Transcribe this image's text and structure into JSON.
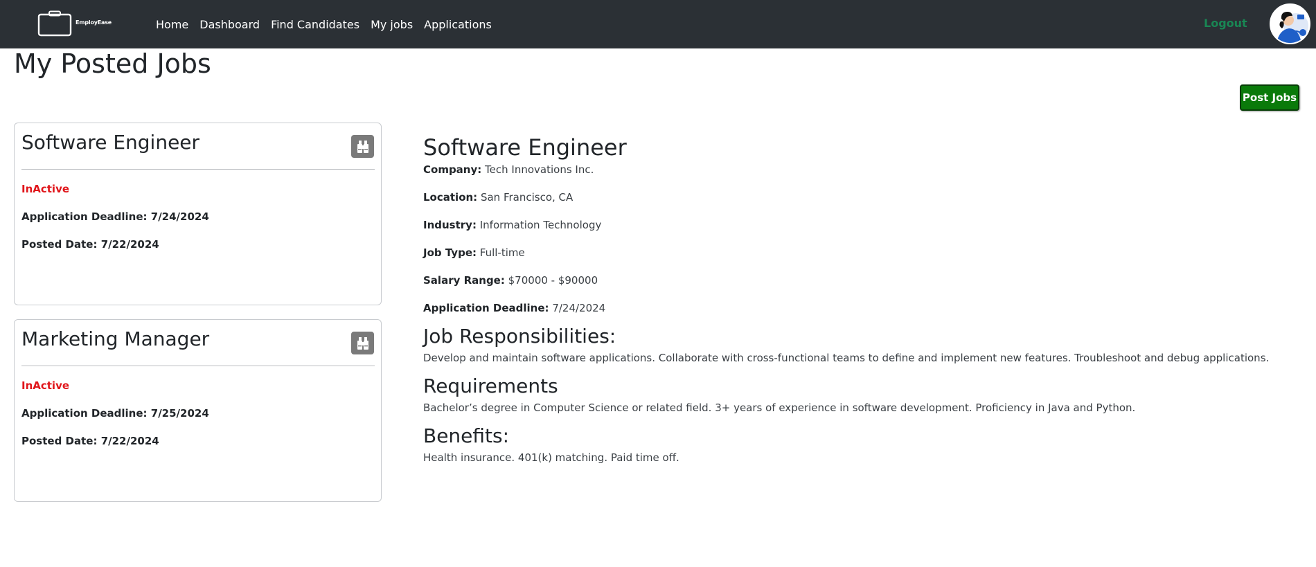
{
  "brand": {
    "name": "EmployEase"
  },
  "nav": {
    "items": [
      {
        "label": "Home"
      },
      {
        "label": "Dashboard"
      },
      {
        "label": "Find Candidates"
      },
      {
        "label": "My jobs"
      },
      {
        "label": "Applications"
      }
    ],
    "logout_label": "Logout"
  },
  "page": {
    "title": "My Posted Jobs",
    "post_button": "Post Jobs"
  },
  "jobs": [
    {
      "title": "Software Engineer",
      "status": "InActive",
      "deadline_label": "Application Deadline:",
      "deadline": "7/24/2024",
      "posted_label": "Posted Date:",
      "posted": "7/22/2024"
    },
    {
      "title": "Marketing Manager",
      "status": "InActive",
      "deadline_label": "Application Deadline:",
      "deadline": "7/25/2024",
      "posted_label": "Posted Date:",
      "posted": "7/22/2024"
    }
  ],
  "detail": {
    "title": "Software Engineer",
    "fields": [
      {
        "label": "Company:",
        "value": "Tech Innovations Inc."
      },
      {
        "label": "Location:",
        "value": "San Francisco, CA"
      },
      {
        "label": "Industry:",
        "value": "Information Technology"
      },
      {
        "label": "Job Type:",
        "value": "Full-time"
      },
      {
        "label": "Salary Range:",
        "value": "$70000 - $90000"
      },
      {
        "label": "Application Deadline:",
        "value": "7/24/2024"
      }
    ],
    "responsibilities_heading": "Job Responsibilities:",
    "responsibilities": "Develop and maintain software applications. Collaborate with cross-functional teams to define and implement new features. Troubleshoot and debug applications.",
    "requirements_heading": "Requirements",
    "requirements": "Bachelor’s degree in Computer Science or related field. 3+ years of experience in software development. Proficiency in Java and Python.",
    "benefits_heading": "Benefits:",
    "benefits": "Health insurance. 401(k) matching. Paid time off."
  },
  "colors": {
    "navbar": "#2b3035",
    "logout": "#198754",
    "status_inactive": "#e0151a",
    "post_button": "#0a7a0a",
    "card_icon_bg": "#7a7a7a"
  },
  "icons": {
    "brand": "briefcase-icon",
    "card_action": "binoculars-icon",
    "avatar": "user-avatar"
  }
}
